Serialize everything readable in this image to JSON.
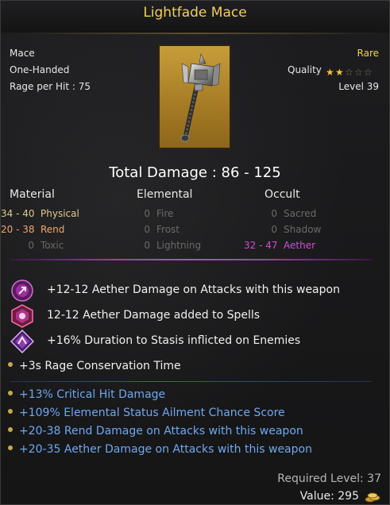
{
  "title": "Lightfade Mace",
  "item": {
    "type": "Mace",
    "handedness": "One-Handed",
    "rage_per_hit": "Rage per Hit : 75",
    "rarity": "Rare",
    "quality_label": "Quality",
    "quality_stars": 2,
    "quality_max": 5,
    "level": "Level 39"
  },
  "total_damage": "Total Damage : 86 - 125",
  "columns": {
    "material": {
      "header": "Material",
      "rows": [
        {
          "value": "34 - 40",
          "label": "Physical",
          "kind": "phys"
        },
        {
          "value": "20 - 38",
          "label": "Rend",
          "kind": "rend"
        },
        {
          "value": "0",
          "label": "Toxic",
          "kind": "zero"
        }
      ]
    },
    "elemental": {
      "header": "Elemental",
      "rows": [
        {
          "value": "0",
          "label": "Fire",
          "kind": "zero"
        },
        {
          "value": "0",
          "label": "Frost",
          "kind": "zero"
        },
        {
          "value": "0",
          "label": "Lightning",
          "kind": "zero"
        }
      ]
    },
    "occult": {
      "header": "Occult",
      "rows": [
        {
          "value": "0",
          "label": "Sacred",
          "kind": "zero"
        },
        {
          "value": "0",
          "label": "Shadow",
          "kind": "zero"
        },
        {
          "value": "32 - 47",
          "label": "Aether",
          "kind": "aether"
        }
      ]
    }
  },
  "augments": [
    {
      "text": "+12-12 Aether Damage on Attacks with this weapon",
      "icon": "aether-attack-icon"
    },
    {
      "text": "12-12 Aether Damage added to Spells",
      "icon": "aether-spell-icon"
    },
    {
      "text": "+16% Duration to Stasis inflicted on Enemies",
      "icon": "stasis-icon"
    }
  ],
  "base_mod": "+3s Rage Conservation Time",
  "bonus_mods": [
    "+13% Critical Hit Damage",
    "+109% Elemental Status Ailment Chance Score",
    "+20-38 Rend Damage on Attacks with this weapon",
    "+20-35 Aether Damage on Attacks with this weapon"
  ],
  "required_level": "Required Level: 37",
  "value": "Value: 295",
  "colors": {
    "title": "#f2d155",
    "rare": "#f2d155",
    "aether": "#d64ad8",
    "bonus_mod": "#6fa8f0"
  }
}
